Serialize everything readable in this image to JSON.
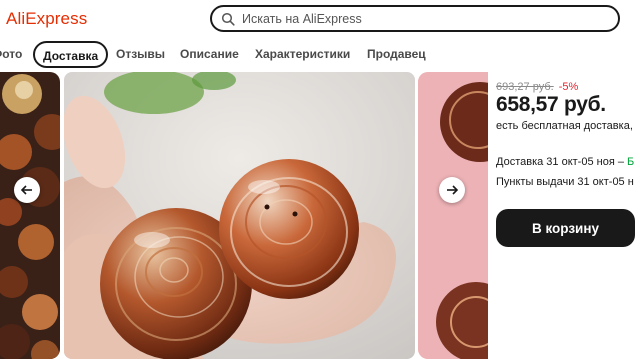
{
  "header": {
    "logo": "AliExpress",
    "search_placeholder": "Искать на AliExpress"
  },
  "tabs": [
    {
      "label": "Фото",
      "active": false
    },
    {
      "label": "Доставка",
      "active": true
    },
    {
      "label": "Отзывы",
      "active": false
    },
    {
      "label": "Описание",
      "active": false
    },
    {
      "label": "Характеристики",
      "active": false
    },
    {
      "label": "Продавец",
      "active": false
    }
  ],
  "product": {
    "old_price": "693,27 руб.",
    "discount": "-5%",
    "price": "658,57 руб.",
    "free_shipping": "есть бесплатная доставка,",
    "delivery_label": "Доставка 31 окт-05 ноя –",
    "delivery_free": "Б",
    "pickup": "Пункты выдачи 31 окт-05 н",
    "cart_button": "В корзину"
  },
  "icons": {
    "search": "search-icon",
    "prev": "arrow-left-icon",
    "next": "arrow-right-icon"
  },
  "colors": {
    "brand": "#e62e04",
    "discount": "#e6242f",
    "free": "#00a33a",
    "button": "#191919"
  }
}
